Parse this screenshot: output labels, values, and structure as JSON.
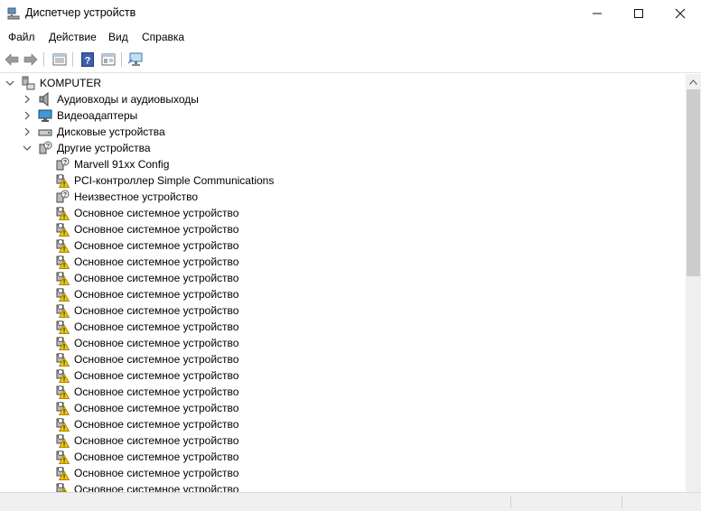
{
  "window": {
    "title": "Диспетчер устройств",
    "icon": "device-manager-icon"
  },
  "menu": {
    "items": [
      "Файл",
      "Действие",
      "Вид",
      "Справка"
    ]
  },
  "toolbar": {
    "buttons": [
      "back-icon",
      "forward-icon",
      "properties-icon",
      "help-icon",
      "view-icon",
      "monitor-scan-icon"
    ]
  },
  "tree": {
    "root": "KOMPUTER",
    "categories": [
      {
        "label": "Аудиовходы и аудиовыходы",
        "icon": "speaker-icon",
        "expanded": false
      },
      {
        "label": "Видеоадаптеры",
        "icon": "display-adapter-icon",
        "expanded": false
      },
      {
        "label": "Дисковые устройства",
        "icon": "disk-drive-icon",
        "expanded": false
      },
      {
        "label": "Другие устройства",
        "icon": "unknown-device-icon",
        "expanded": true
      }
    ],
    "other_devices": [
      {
        "label": "Marvell 91xx Config",
        "icon": "unknown-device-icon"
      },
      {
        "label": "PCI-контроллер Simple Communications",
        "icon": "warning-device-icon"
      },
      {
        "label": "Неизвестное устройство",
        "icon": "unknown-device-icon"
      },
      {
        "label": "Основное системное устройство",
        "icon": "warning-device-icon"
      },
      {
        "label": "Основное системное устройство",
        "icon": "warning-device-icon"
      },
      {
        "label": "Основное системное устройство",
        "icon": "warning-device-icon"
      },
      {
        "label": "Основное системное устройство",
        "icon": "warning-device-icon"
      },
      {
        "label": "Основное системное устройство",
        "icon": "warning-device-icon"
      },
      {
        "label": "Основное системное устройство",
        "icon": "warning-device-icon"
      },
      {
        "label": "Основное системное устройство",
        "icon": "warning-device-icon"
      },
      {
        "label": "Основное системное устройство",
        "icon": "warning-device-icon"
      },
      {
        "label": "Основное системное устройство",
        "icon": "warning-device-icon"
      },
      {
        "label": "Основное системное устройство",
        "icon": "warning-device-icon"
      },
      {
        "label": "Основное системное устройство",
        "icon": "warning-device-icon"
      },
      {
        "label": "Основное системное устройство",
        "icon": "warning-device-icon"
      },
      {
        "label": "Основное системное устройство",
        "icon": "warning-device-icon"
      },
      {
        "label": "Основное системное устройство",
        "icon": "warning-device-icon"
      },
      {
        "label": "Основное системное устройство",
        "icon": "warning-device-icon"
      },
      {
        "label": "Основное системное устройство",
        "icon": "warning-device-icon"
      },
      {
        "label": "Основное системное устройство",
        "icon": "warning-device-icon"
      },
      {
        "label": "Основное системное устройство",
        "icon": "warning-device-icon"
      }
    ]
  },
  "colors": {
    "warning": "#f2c300",
    "accent": "#2b6cc4",
    "scroll_thumb": "#cdcdcd"
  }
}
